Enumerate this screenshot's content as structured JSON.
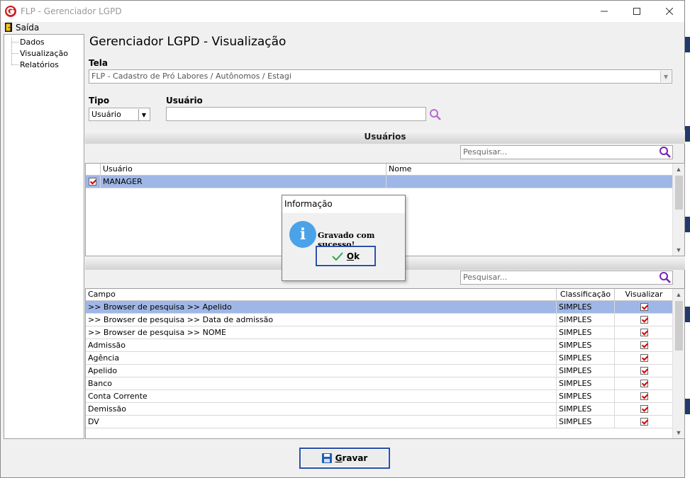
{
  "window": {
    "title": "FLP - Gerenciador LGPD"
  },
  "menu": {
    "exit_label": "Saída"
  },
  "tree": {
    "items": [
      {
        "label": "Dados"
      },
      {
        "label": "Visualização"
      },
      {
        "label": "Relatórios"
      }
    ]
  },
  "page": {
    "title": "Gerenciador LGPD - Visualização"
  },
  "tela": {
    "label": "Tela",
    "value": "FLP - Cadastro de Pró Labores / Autônomos / Estagi"
  },
  "tipo": {
    "label": "Tipo",
    "value": "Usuário"
  },
  "usuario": {
    "label": "Usuário",
    "value": ""
  },
  "usuarios_section": {
    "title": "Usuários",
    "search_placeholder": "Pesquisar...",
    "columns": [
      "Usuário",
      "Nome"
    ],
    "rows": [
      {
        "usuario": "MANAGER",
        "nome": "",
        "checked": true
      }
    ]
  },
  "campos_section": {
    "search_placeholder": "Pesquisar...",
    "columns": [
      "Campo",
      "Classificação",
      "Visualizar"
    ],
    "rows": [
      {
        "campo": ">> Browser de pesquisa >> Apelido",
        "classificacao": "SIMPLES",
        "visualizar": true
      },
      {
        "campo": ">> Browser de pesquisa >> Data de admissão",
        "classificacao": "SIMPLES",
        "visualizar": true
      },
      {
        "campo": ">> Browser de pesquisa >> NOME",
        "classificacao": "SIMPLES",
        "visualizar": true
      },
      {
        "campo": "Admissão",
        "classificacao": "SIMPLES",
        "visualizar": true
      },
      {
        "campo": "Agência",
        "classificacao": "SIMPLES",
        "visualizar": true
      },
      {
        "campo": "Apelido",
        "classificacao": "SIMPLES",
        "visualizar": true
      },
      {
        "campo": "Banco",
        "classificacao": "SIMPLES",
        "visualizar": true
      },
      {
        "campo": "Conta Corrente",
        "classificacao": "SIMPLES",
        "visualizar": true
      },
      {
        "campo": "Demissão",
        "classificacao": "SIMPLES",
        "visualizar": true
      },
      {
        "campo": "DV",
        "classificacao": "SIMPLES",
        "visualizar": true
      }
    ]
  },
  "dialog": {
    "title": "Informação",
    "message": "Gravado com sucesso!",
    "ok_first": "O",
    "ok_rest": "k"
  },
  "footer": {
    "save_first": "G",
    "save_rest": "ravar"
  },
  "colors": {
    "selection": "#9fb7e6",
    "accent": "#2a4fa8",
    "check": "#d10000",
    "info": "#4aa3e8",
    "logo": "#cc1f1f"
  }
}
